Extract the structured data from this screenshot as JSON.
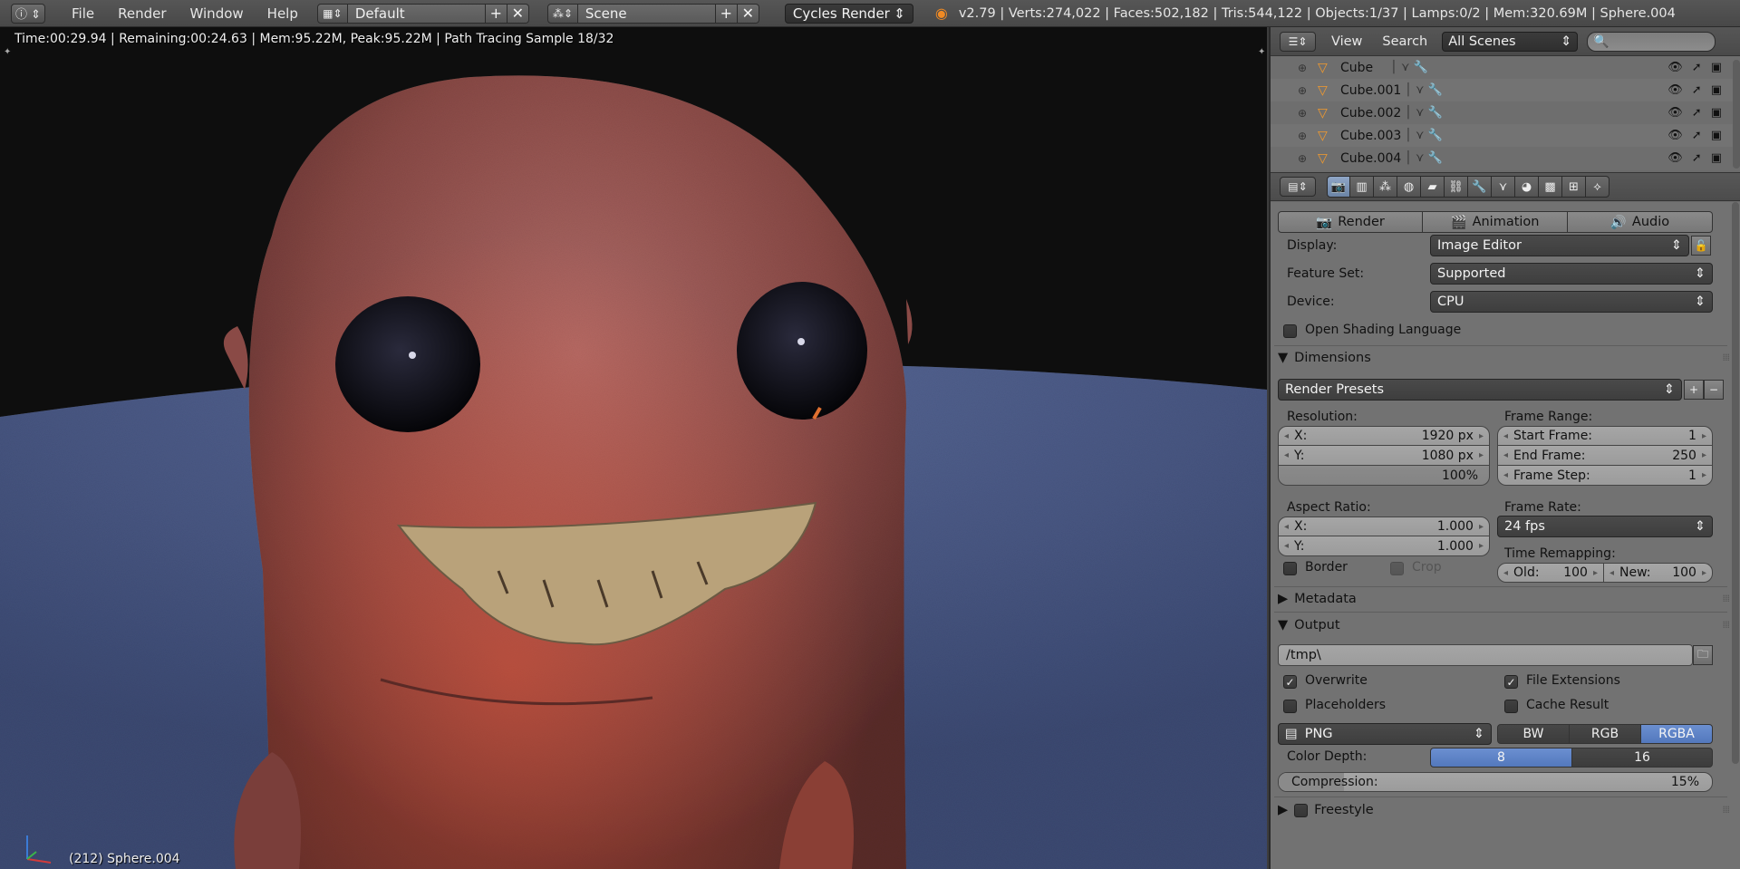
{
  "topbar": {
    "info_icon": "info-icon",
    "menus": [
      "File",
      "Render",
      "Window",
      "Help"
    ],
    "screen_layout": "Default",
    "scene": "Scene",
    "engine": "Cycles Render",
    "stats": "v2.79 | Verts:274,022 | Faces:502,182 | Tris:544,122 | Objects:1/37 | Lamps:0/2 | Mem:320.69M | Sphere.004"
  },
  "viewport": {
    "status": "Time:00:29.94 | Remaining:00:24.63 | Mem:95.22M, Peak:95.22M | Path Tracing Sample 18/32",
    "object_label": "(212) Sphere.004"
  },
  "outliner": {
    "menus": [
      "View",
      "Search"
    ],
    "filter": "All Scenes",
    "search_placeholder": "",
    "items": [
      {
        "name": "Cube"
      },
      {
        "name": "Cube.001"
      },
      {
        "name": "Cube.002"
      },
      {
        "name": "Cube.003"
      },
      {
        "name": "Cube.004"
      }
    ]
  },
  "properties": {
    "context_icons": [
      "render-icon",
      "render-layers-icon",
      "scene-icon",
      "world-icon",
      "object-icon",
      "constraints-icon",
      "modifiers-icon",
      "data-icon",
      "material-icon",
      "texture-icon",
      "particles-icon"
    ],
    "tabs": {
      "render": "Render",
      "animation": "Animation",
      "audio": "Audio"
    },
    "display_label": "Display:",
    "display_value": "Image Editor",
    "feature_set_label": "Feature Set:",
    "feature_set_value": "Supported",
    "device_label": "Device:",
    "device_value": "CPU",
    "osl_label": "Open Shading Language",
    "dimensions": {
      "title": "Dimensions",
      "presets": "Render Presets",
      "resolution_label": "Resolution:",
      "res_x_label": "X:",
      "res_x": "1920 px",
      "res_y_label": "Y:",
      "res_y": "1080 px",
      "res_pct": "100%",
      "frame_range_label": "Frame Range:",
      "start_label": "Start Frame:",
      "start": "1",
      "end_label": "End Frame:",
      "end": "250",
      "step_label": "Frame Step:",
      "step": "1",
      "aspect_label": "Aspect Ratio:",
      "asp_x_label": "X:",
      "asp_x": "1.000",
      "asp_y_label": "Y:",
      "asp_y": "1.000",
      "frame_rate_label": "Frame Rate:",
      "frame_rate": "24 fps",
      "time_remap_label": "Time Remapping:",
      "old_label": "Old:",
      "old": "100",
      "new_label": "New:",
      "new": "100",
      "border_label": "Border",
      "crop_label": "Crop"
    },
    "metadata_title": "Metadata",
    "output": {
      "title": "Output",
      "path": "/tmp\\",
      "overwrite": "Overwrite",
      "file_ext": "File Extensions",
      "placeholders": "Placeholders",
      "cache": "Cache Result",
      "format": "PNG",
      "color_modes": [
        "BW",
        "RGB",
        "RGBA"
      ],
      "active_color_mode": "RGBA",
      "color_depth_label": "Color Depth:",
      "depths": [
        "8",
        "16"
      ],
      "active_depth": "8",
      "compression_label": "Compression:",
      "compression": "15%",
      "compression_fraction": 0.15
    },
    "freestyle_title": "Freestyle"
  },
  "colors": {
    "accent_blue": "#5a7fc4",
    "blender_orange": "#f08a24",
    "panel_bg": "#727272"
  }
}
